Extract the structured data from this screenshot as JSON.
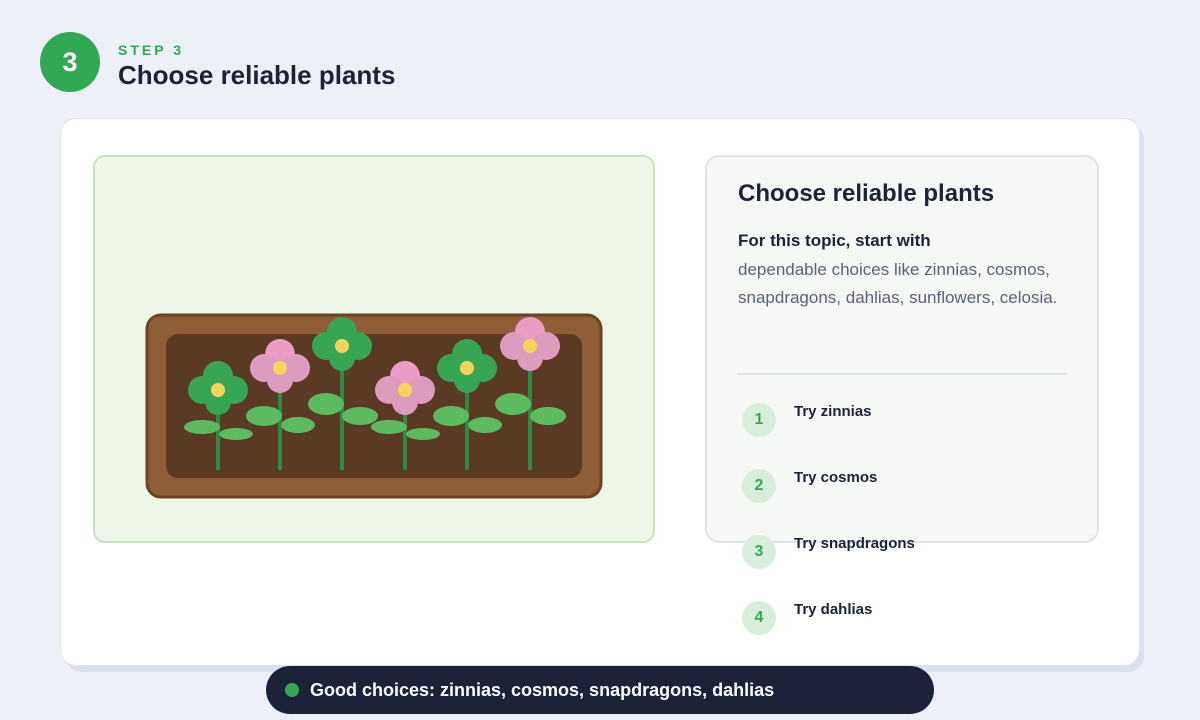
{
  "header": {
    "step_number": "3",
    "step_label": "STEP 3",
    "title": "Choose reliable plants"
  },
  "illustration": {
    "name": "planter-box-with-flowers"
  },
  "info": {
    "title": "Choose reliable plants",
    "lead": "For this topic, start with",
    "body": "dependable choices like zinnias, cosmos, snapdragons, dahlias, sunflowers, celosia.",
    "items": [
      {
        "number": "1",
        "label": "Try zinnias"
      },
      {
        "number": "2",
        "label": "Try cosmos"
      },
      {
        "number": "3",
        "label": "Try snapdragons"
      },
      {
        "number": "4",
        "label": "Try dahlias"
      }
    ]
  },
  "footer": {
    "text": "Good choices: zinnias, cosmos, snapdragons, dahlias"
  },
  "colors": {
    "accent_green": "#33a852",
    "navy": "#1c2237",
    "flower_pink": "#e89ac0",
    "flower_green": "#37a653",
    "soil": "#5a3a22",
    "planter_wood": "#8f5e36"
  }
}
